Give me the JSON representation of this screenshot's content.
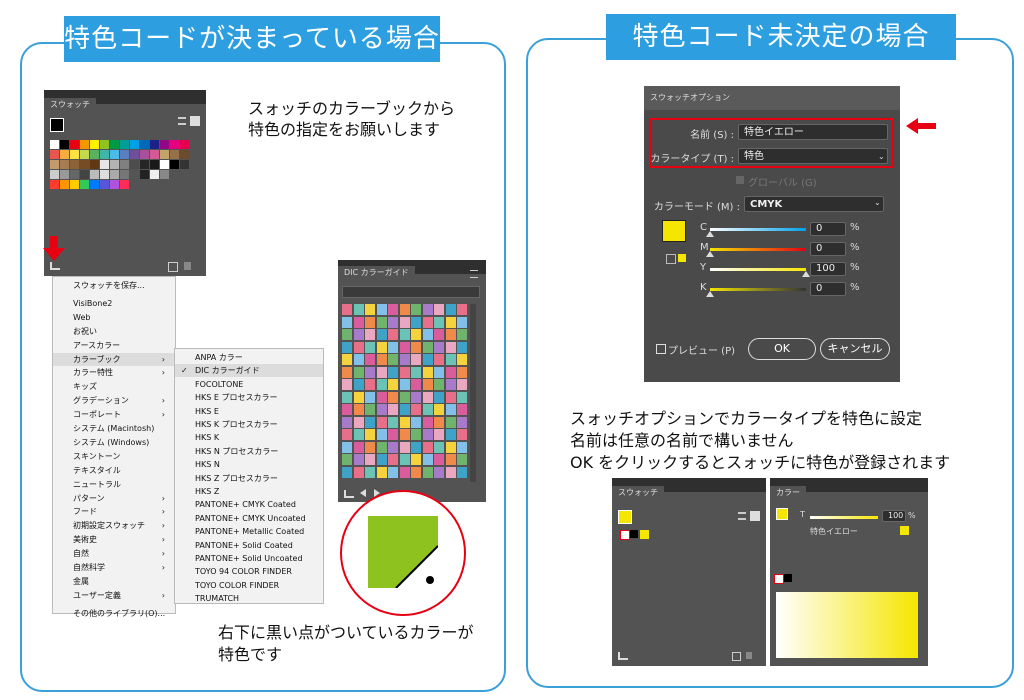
{
  "left_section": {
    "banner": "特色コードが決まっている場合",
    "note_top_1": "スォッチのカラーブックから",
    "note_top_2": "特色の指定をお願いします",
    "note_bottom_1": "右下に黒い点がついているカラーが",
    "note_bottom_2": "特色です",
    "swatch_panel": {
      "tab": "スウォッチ"
    },
    "library_menu": [
      "スウォッチを保存...",
      "VisiBone2",
      "Web",
      "お祝い",
      "アースカラー",
      "カラーブック",
      "カラー特性",
      "キッズ",
      "グラデーション",
      "コーポレート",
      "システム (Macintosh)",
      "システム (Windows)",
      "スキントーン",
      "テキスタイル",
      "ニュートラル",
      "パターン",
      "フード",
      "初期設定スウォッチ",
      "美術史",
      "自然",
      "自然科学",
      "金属",
      "ユーザー定義",
      "その他のライブラリ(O)..."
    ],
    "color_book_menu": [
      "ANPA カラー",
      "DIC カラーガイド",
      "FOCOLTONE",
      "HKS E プロセスカラー",
      "HKS E",
      "HKS K プロセスカラー",
      "HKS K",
      "HKS N プロセスカラー",
      "HKS N",
      "HKS Z プロセスカラー",
      "HKS Z",
      "PANTONE+ CMYK Coated",
      "PANTONE+ CMYK Uncoated",
      "PANTONE+ Metallic Coated",
      "PANTONE+ Solid Coated",
      "PANTONE+ Solid Uncoated",
      "TOYO 94 COLOR FINDER",
      "TOYO COLOR FINDER",
      "TRUMATCH"
    ],
    "dic_panel": {
      "tab": "DIC カラーガイド"
    },
    "zoom_color": "#8dc21f"
  },
  "right_section": {
    "banner": "特色コード未決定の場合",
    "dialog": {
      "title": "スウォッチオプション",
      "name_label": "名前 (S) :",
      "name_value": "特色イエロー",
      "type_label": "カラータイプ (T) :",
      "type_value": "特色",
      "global_label": "グローバル (G)",
      "mode_label": "カラーモード (M) :",
      "mode_value": "CMYK",
      "channels": [
        {
          "label": "C",
          "value": "0"
        },
        {
          "label": "M",
          "value": "0"
        },
        {
          "label": "Y",
          "value": "100"
        },
        {
          "label": "K",
          "value": "0"
        }
      ],
      "percent": "%",
      "preview_label": "プレビュー (P)",
      "ok_label": "OK",
      "cancel_label": "キャンセル"
    },
    "note_1": "スォッチオプションでカラータイプを特色に設定",
    "note_2": "名前は任意の名前で構いません",
    "note_3": "OK をクリックするとスォッチに特色が登録されます",
    "swatch_panel": {
      "tab": "スウォッチ"
    },
    "color_panel": {
      "tab": "カラー",
      "t_label": "T",
      "t_value": "100",
      "percent": "%",
      "color_name": "特色イエロー"
    },
    "spot_color": "#f5e600"
  }
}
